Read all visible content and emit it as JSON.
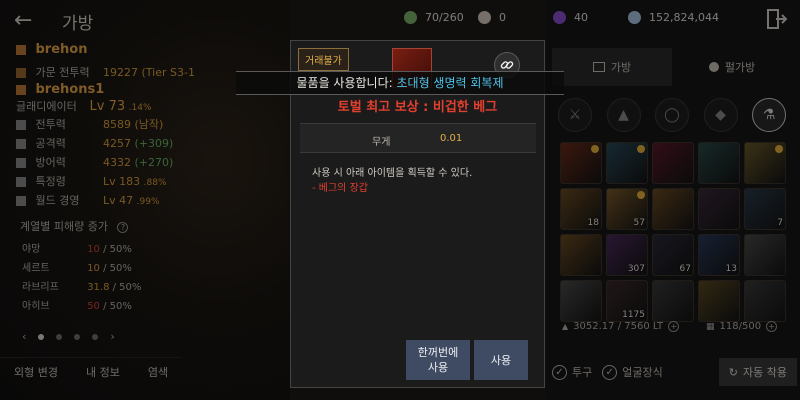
{
  "header": {
    "title": "가방"
  },
  "currencies": [
    {
      "icon": "energy-icon",
      "value": "70/260",
      "color": "#7cb46a"
    },
    {
      "icon": "pearl-icon",
      "value": "0",
      "color": "#d9c6c0"
    },
    {
      "icon": "gem-icon",
      "value": "40",
      "color": "#8a4fd1"
    },
    {
      "icon": "silver-coin-icon",
      "value": "152,824,044",
      "color": "#a9c7e6"
    }
  ],
  "character": {
    "family_name": "brehon",
    "family_power_label": "가문 전투력",
    "family_power_value": "19227 (Tier S3-1",
    "char_name": "brehons1",
    "class": "글래디에이터",
    "level": "Lv 73",
    "level_pct": ".14%",
    "stats": [
      {
        "label": "전투력",
        "value": "8589 (남작)",
        "bonus": ""
      },
      {
        "label": "공격력",
        "value": "4257",
        "bonus": "(+309)"
      },
      {
        "label": "방어력",
        "value": "4332",
        "bonus": "(+270)"
      },
      {
        "label": "특정령",
        "value": "Lv 183",
        "bonus": ".88%"
      },
      {
        "label": "월드 경영",
        "value": "Lv 47",
        "bonus": ".99%"
      }
    ]
  },
  "resistance": {
    "title": "계열별 피해량 증가",
    "rows": [
      {
        "label": "야망",
        "value": "10",
        "max": " / 50%",
        "red": true
      },
      {
        "label": "세르트",
        "value": "10",
        "max": " / 50%",
        "red": false
      },
      {
        "label": "라브리프",
        "value": "31.8",
        "max": " / 50%",
        "red": false
      },
      {
        "label": "아히브",
        "value": "50",
        "max": " / 50%",
        "red": true
      }
    ]
  },
  "bottom_tabs": [
    "외형 변경",
    "내 정보",
    "염색"
  ],
  "inventory": {
    "tabs": [
      "가방",
      "펄가방"
    ],
    "items": [
      {
        "qty": "",
        "badge": true,
        "color": "#6b2b1a"
      },
      {
        "qty": "",
        "badge": true,
        "color": "#2a4a5a"
      },
      {
        "qty": "",
        "badge": false,
        "color": "#5a1a2a"
      },
      {
        "qty": "",
        "badge": false,
        "color": "#2a4a4a"
      },
      {
        "qty": "",
        "badge": true,
        "color": "#6a5a2a"
      },
      {
        "qty": "18",
        "badge": false,
        "color": "#6a4a22"
      },
      {
        "qty": "57",
        "badge": true,
        "color": "#7a5a2a"
      },
      {
        "qty": "",
        "badge": false,
        "color": "#6a4a22"
      },
      {
        "qty": "",
        "badge": false,
        "color": "#3a2a3a"
      },
      {
        "qty": "7",
        "badge": false,
        "color": "#2a3a4a"
      },
      {
        "qty": "",
        "badge": false,
        "color": "#6a4a22"
      },
      {
        "qty": "307",
        "badge": false,
        "color": "#4a2a5a"
      },
      {
        "qty": "67",
        "badge": false,
        "color": "#2a2a3a"
      },
      {
        "qty": "13",
        "badge": false,
        "color": "#2a3a5a"
      },
      {
        "qty": "",
        "badge": false,
        "color": "#4a4a4a"
      },
      {
        "qty": "",
        "badge": false,
        "color": "#4a4a4a"
      },
      {
        "qty": "1175",
        "badge": false,
        "color": "#3a2a2a"
      },
      {
        "qty": "",
        "badge": false,
        "color": "#3a3a3a"
      },
      {
        "qty": "",
        "badge": false,
        "color": "#5a4a22"
      },
      {
        "qty": "",
        "badge": false,
        "color": "#3a3a3a"
      }
    ],
    "weight": "3052.17 / 7560 LT",
    "slots": "118/500",
    "footer": {
      "helmet": "투구",
      "face_deco": "얼굴장식",
      "auto_equip": "자동 착용"
    }
  },
  "item_popup": {
    "untradeable_label": "거래불가",
    "use_toast_prefix": "물품을 사용합니다: ",
    "use_toast_item": "초대형 생명력 회복제",
    "item_name": "토벌 최고 보상 : 비겁한 베그",
    "weight_label": "무게",
    "weight_value": "0.01",
    "description": "사용 시 아래 아이템을 획득할 수 있다.",
    "reward": "- 베그의 장갑",
    "bulk_use_line1": "한꺼번에",
    "bulk_use_line2": "사용",
    "use_label": "사용"
  }
}
